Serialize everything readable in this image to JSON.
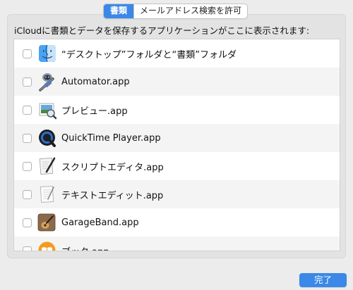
{
  "tabs": [
    {
      "label": "書類",
      "active": true
    },
    {
      "label": "メールアドレス検索を許可",
      "active": false
    }
  ],
  "description": "iCloudに書類とデータを保存するアプリケーションがここに表示されます:",
  "apps": [
    {
      "label": "“デスクトップ”フォルダと“書類”フォルダ",
      "icon": "finder-icon",
      "checked": false
    },
    {
      "label": "Automator.app",
      "icon": "automator-icon",
      "checked": false
    },
    {
      "label": "プレビュー.app",
      "icon": "preview-icon",
      "checked": false
    },
    {
      "label": "QuickTime Player.app",
      "icon": "quicktime-icon",
      "checked": false
    },
    {
      "label": "スクリプトエディタ.app",
      "icon": "script-editor-icon",
      "checked": false
    },
    {
      "label": "テキストエディット.app",
      "icon": "textedit-icon",
      "checked": false
    },
    {
      "label": "GarageBand.app",
      "icon": "garageband-icon",
      "checked": false
    },
    {
      "label": "ブック.app",
      "icon": "books-icon",
      "checked": false
    }
  ],
  "done_label": "完了",
  "colors": {
    "accent": "#3b88e8"
  }
}
